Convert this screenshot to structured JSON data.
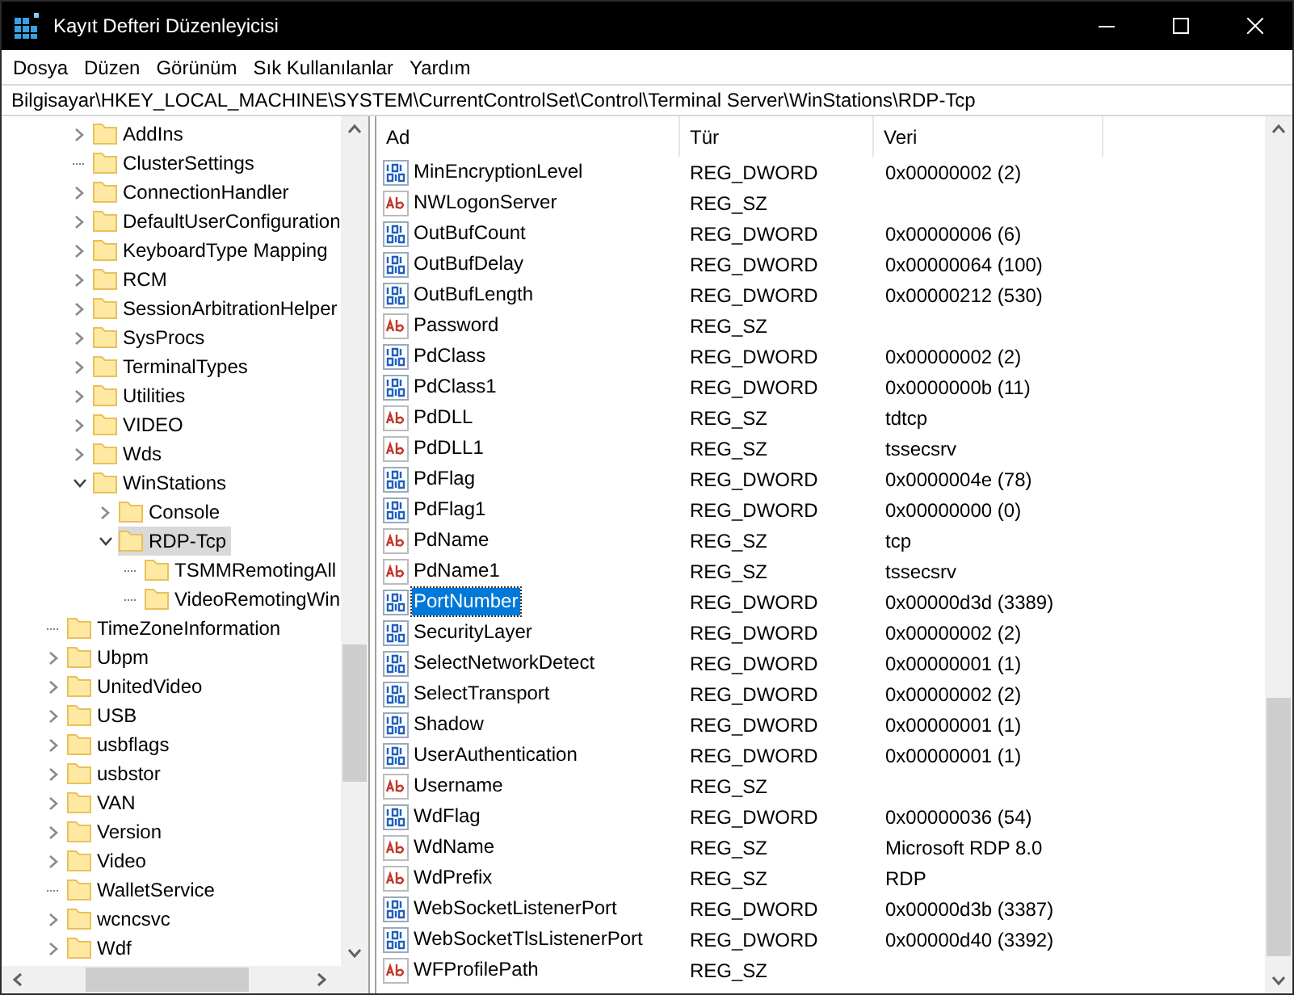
{
  "window": {
    "title": "Kayıt Defteri Düzenleyicisi"
  },
  "menu": [
    "Dosya",
    "Düzen",
    "Görünüm",
    "Sık Kullanılanlar",
    "Yardım"
  ],
  "address": "Bilgisayar\\HKEY_LOCAL_MACHINE\\SYSTEM\\CurrentControlSet\\Control\\Terminal Server\\WinStations\\RDP-Tcp",
  "tree": {
    "nested_items": [
      {
        "label": "AddIns",
        "kind": "collapsed",
        "selected": false
      },
      {
        "label": "ClusterSettings",
        "kind": "leaf",
        "selected": false
      },
      {
        "label": "ConnectionHandler",
        "kind": "collapsed",
        "selected": false
      },
      {
        "label": "DefaultUserConfiguration",
        "kind": "collapsed",
        "selected": false
      },
      {
        "label": "KeyboardType Mapping",
        "kind": "collapsed",
        "selected": false
      },
      {
        "label": "RCM",
        "kind": "collapsed",
        "selected": false
      },
      {
        "label": "SessionArbitrationHelper",
        "kind": "collapsed",
        "selected": false
      },
      {
        "label": "SysProcs",
        "kind": "collapsed",
        "selected": false
      },
      {
        "label": "TerminalTypes",
        "kind": "collapsed",
        "selected": false
      },
      {
        "label": "Utilities",
        "kind": "collapsed",
        "selected": false
      },
      {
        "label": "VIDEO",
        "kind": "collapsed",
        "selected": false
      },
      {
        "label": "Wds",
        "kind": "collapsed",
        "selected": false
      },
      {
        "label": "WinStations",
        "kind": "expanded",
        "selected": false,
        "children": [
          {
            "label": "Console",
            "kind": "collapsed",
            "selected": false
          },
          {
            "label": "RDP-Tcp",
            "kind": "expanded",
            "selected": true,
            "children": [
              {
                "label": "TSMMRemotingAll",
                "kind": "leaf",
                "selected": false
              },
              {
                "label": "VideoRemotingWin",
                "kind": "leaf",
                "selected": false
              }
            ]
          }
        ]
      }
    ],
    "outer_items": [
      {
        "label": "TimeZoneInformation",
        "kind": "leaf",
        "selected": false
      },
      {
        "label": "Ubpm",
        "kind": "collapsed",
        "selected": false
      },
      {
        "label": "UnitedVideo",
        "kind": "collapsed",
        "selected": false
      },
      {
        "label": "USB",
        "kind": "collapsed",
        "selected": false
      },
      {
        "label": "usbflags",
        "kind": "collapsed",
        "selected": false
      },
      {
        "label": "usbstor",
        "kind": "collapsed",
        "selected": false
      },
      {
        "label": "VAN",
        "kind": "collapsed",
        "selected": false
      },
      {
        "label": "Version",
        "kind": "collapsed",
        "selected": false
      },
      {
        "label": "Video",
        "kind": "collapsed",
        "selected": false
      },
      {
        "label": "WalletService",
        "kind": "leaf",
        "selected": false
      },
      {
        "label": "wcncsvc",
        "kind": "collapsed",
        "selected": false
      },
      {
        "label": "Wdf",
        "kind": "collapsed",
        "selected": false
      }
    ]
  },
  "table": {
    "columns": [
      "Ad",
      "Tür",
      "Veri"
    ],
    "rows": [
      {
        "name": "MinEncryptionLevel",
        "type": "REG_DWORD",
        "data": "0x00000002 (2)",
        "kind": "binary",
        "selected": false
      },
      {
        "name": "NWLogonServer",
        "type": "REG_SZ",
        "kind": "string",
        "selected": false
      },
      {
        "name": "OutBufCount",
        "type": "REG_DWORD",
        "data": "0x00000006 (6)",
        "kind": "binary",
        "selected": false
      },
      {
        "name": "OutBufDelay",
        "type": "REG_DWORD",
        "data": "0x00000064 (100)",
        "kind": "binary",
        "selected": false
      },
      {
        "name": "OutBufLength",
        "type": "REG_DWORD",
        "data": "0x00000212 (530)",
        "kind": "binary",
        "selected": false
      },
      {
        "name": "Password",
        "type": "REG_SZ",
        "kind": "string",
        "selected": false
      },
      {
        "name": "PdClass",
        "type": "REG_DWORD",
        "data": "0x00000002 (2)",
        "kind": "binary",
        "selected": false
      },
      {
        "name": "PdClass1",
        "type": "REG_DWORD",
        "data": "0x0000000b (11)",
        "kind": "binary",
        "selected": false
      },
      {
        "name": "PdDLL",
        "type": "REG_SZ",
        "data": "tdtcp",
        "kind": "string",
        "selected": false
      },
      {
        "name": "PdDLL1",
        "type": "REG_SZ",
        "data": "tssecsrv",
        "kind": "string",
        "selected": false
      },
      {
        "name": "PdFlag",
        "type": "REG_DWORD",
        "data": "0x0000004e (78)",
        "kind": "binary",
        "selected": false
      },
      {
        "name": "PdFlag1",
        "type": "REG_DWORD",
        "data": "0x00000000 (0)",
        "kind": "binary",
        "selected": false
      },
      {
        "name": "PdName",
        "type": "REG_SZ",
        "data": "tcp",
        "kind": "string",
        "selected": false
      },
      {
        "name": "PdName1",
        "type": "REG_SZ",
        "data": "tssecsrv",
        "kind": "string",
        "selected": false
      },
      {
        "name": "PortNumber",
        "type": "REG_DWORD",
        "data": "0x00000d3d (3389)",
        "kind": "binary",
        "selected": true
      },
      {
        "name": "SecurityLayer",
        "type": "REG_DWORD",
        "data": "0x00000002 (2)",
        "kind": "binary",
        "selected": false
      },
      {
        "name": "SelectNetworkDetect",
        "type": "REG_DWORD",
        "data": "0x00000001 (1)",
        "kind": "binary",
        "selected": false
      },
      {
        "name": "SelectTransport",
        "type": "REG_DWORD",
        "data": "0x00000002 (2)",
        "kind": "binary",
        "selected": false
      },
      {
        "name": "Shadow",
        "type": "REG_DWORD",
        "data": "0x00000001 (1)",
        "kind": "binary",
        "selected": false
      },
      {
        "name": "UserAuthentication",
        "type": "REG_DWORD",
        "data": "0x00000001 (1)",
        "kind": "binary",
        "selected": false
      },
      {
        "name": "Username",
        "type": "REG_SZ",
        "kind": "string",
        "selected": false
      },
      {
        "name": "WdFlag",
        "type": "REG_DWORD",
        "data": "0x00000036 (54)",
        "kind": "binary",
        "selected": false
      },
      {
        "name": "WdName",
        "type": "REG_SZ",
        "data": "Microsoft RDP 8.0",
        "kind": "string",
        "selected": false
      },
      {
        "name": "WdPrefix",
        "type": "REG_SZ",
        "data": "RDP",
        "kind": "string",
        "selected": false
      },
      {
        "name": "WebSocketListenerPort",
        "type": "REG_DWORD",
        "data": "0x00000d3b (3387)",
        "kind": "binary",
        "selected": false
      },
      {
        "name": "WebSocketTlsListenerPort",
        "type": "REG_DWORD",
        "data": "0x00000d40 (3392)",
        "kind": "binary",
        "selected": false
      },
      {
        "name": "WFProfilePath",
        "type": "REG_SZ",
        "kind": "string",
        "selected": false
      }
    ]
  }
}
